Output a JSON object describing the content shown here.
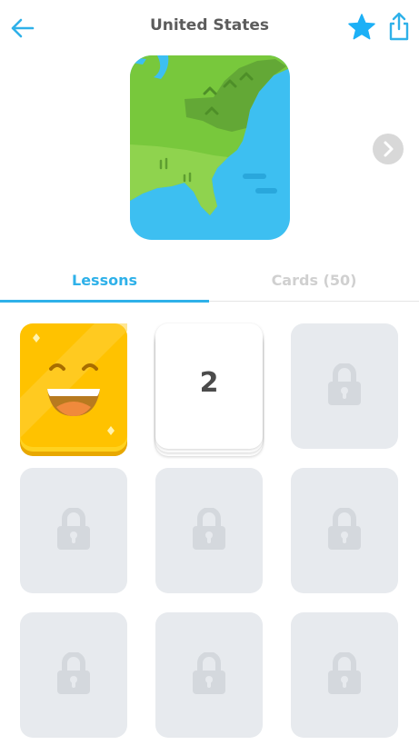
{
  "header": {
    "title": "United States",
    "back_icon": "arrow-left-icon",
    "favorite_icon": "star-icon",
    "share_icon": "share-icon"
  },
  "tabs": [
    {
      "label": "Lessons",
      "active": true
    },
    {
      "label": "Cards (50)",
      "active": false
    }
  ],
  "lessons": [
    {
      "state": "completed",
      "icon": "happy-face-icon"
    },
    {
      "state": "current",
      "label": "2"
    },
    {
      "state": "locked",
      "icon": "lock-icon"
    },
    {
      "state": "locked",
      "icon": "lock-icon"
    },
    {
      "state": "locked",
      "icon": "lock-icon"
    },
    {
      "state": "locked",
      "icon": "lock-icon"
    },
    {
      "state": "locked",
      "icon": "lock-icon"
    },
    {
      "state": "locked",
      "icon": "lock-icon"
    },
    {
      "state": "locked",
      "icon": "lock-icon"
    }
  ],
  "colors": {
    "accent": "#2fb1e9",
    "star": "#1cb0f6",
    "gold": "#ffc200",
    "locked_tile": "#e7eaee",
    "map_water": "#3dbff1",
    "map_land": "#78c83c"
  }
}
